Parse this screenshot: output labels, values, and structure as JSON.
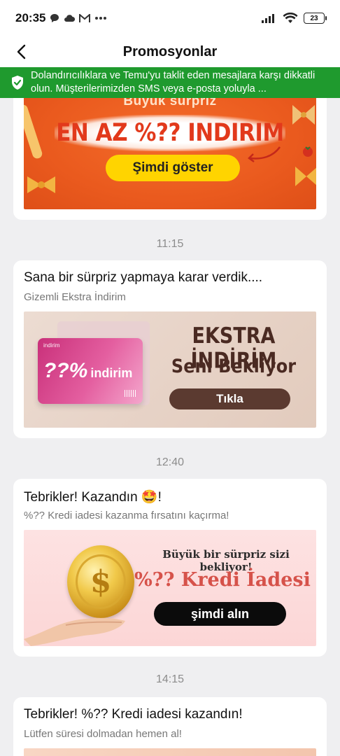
{
  "status_bar": {
    "time": "20:35",
    "left_icons": [
      "chat-bubble-icon",
      "cloud-icon",
      "gmail-icon",
      "more-dots-icon"
    ],
    "right_icons": [
      "signal-icon",
      "wifi-icon"
    ],
    "battery": "23"
  },
  "header": {
    "title": "Promosyonlar",
    "back_icon": "back-arrow-icon"
  },
  "security_banner": {
    "text": "Dolandırıcılıklara ve Temu'yu taklit eden mesajlara karşı dikkatli olun. Müşterilerimizden SMS veya e-posta yoluyla ...",
    "color": "#1f9a2e"
  },
  "messages": [
    {
      "banner": {
        "top_text": "Büyük sürpriz",
        "headline": "EN AZ %?? INDIRIM",
        "button": "Şimdi göster"
      }
    },
    {
      "time": "11:15",
      "title": "Sana bir sürpriz yapmaya karar verdik....",
      "subtitle": "Gizemli Ekstra İndirim",
      "banner": {
        "card_brand": "indirim",
        "card_percent": "??%",
        "card_word": "indirim",
        "headline1": "EKSTRA İNDİRİM",
        "headline2": "Seni Bekliyor",
        "button": "Tıkla"
      }
    },
    {
      "time": "12:40",
      "title": "Tebrikler! Kazandın 🤩!",
      "subtitle": "%?? Kredi iadesi kazanma fırsatını kaçırma!",
      "banner": {
        "line1": "Büyük bir sürpriz sizi bekliyor!",
        "line2": "%?? Kredi İadesi",
        "button": "şimdi alın",
        "coin_symbol": "$"
      }
    },
    {
      "time": "14:15",
      "title": "Tebrikler! %?? Kredi iadesi kazandın!",
      "subtitle": "Lütfen süresi dolmadan hemen al!"
    }
  ],
  "colors": {
    "orange_banner": "#ea5a1e",
    "yellow_button": "#ffd400",
    "brown_button": "#5b3a30",
    "coral_text": "#d6524a"
  }
}
